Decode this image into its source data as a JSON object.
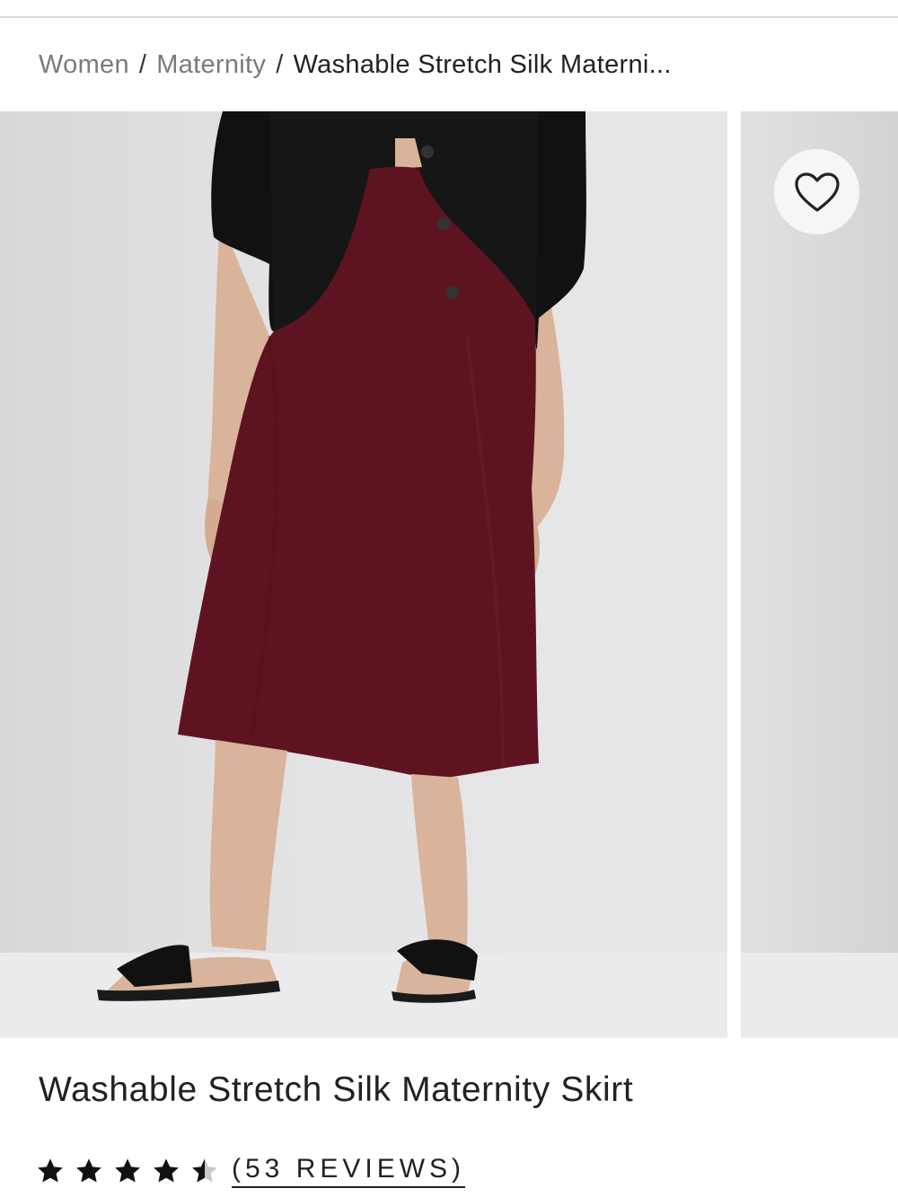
{
  "breadcrumb": {
    "items": [
      "Women",
      "Maternity"
    ],
    "separator": "/",
    "current": "Washable Stretch Silk Materni..."
  },
  "gallery": {
    "favorite_icon": "heart-outline-icon",
    "images": [
      "model-wearing-burgundy-skirt",
      "next-product-image"
    ]
  },
  "product": {
    "title": "Washable Stretch Silk Maternity Skirt",
    "rating": 4.5,
    "rating_max": 5,
    "reviews_label": "(53 REVIEWS)"
  },
  "colors": {
    "skirt": "#5e1420",
    "text": "#222222",
    "muted": "#7a7a7a"
  }
}
